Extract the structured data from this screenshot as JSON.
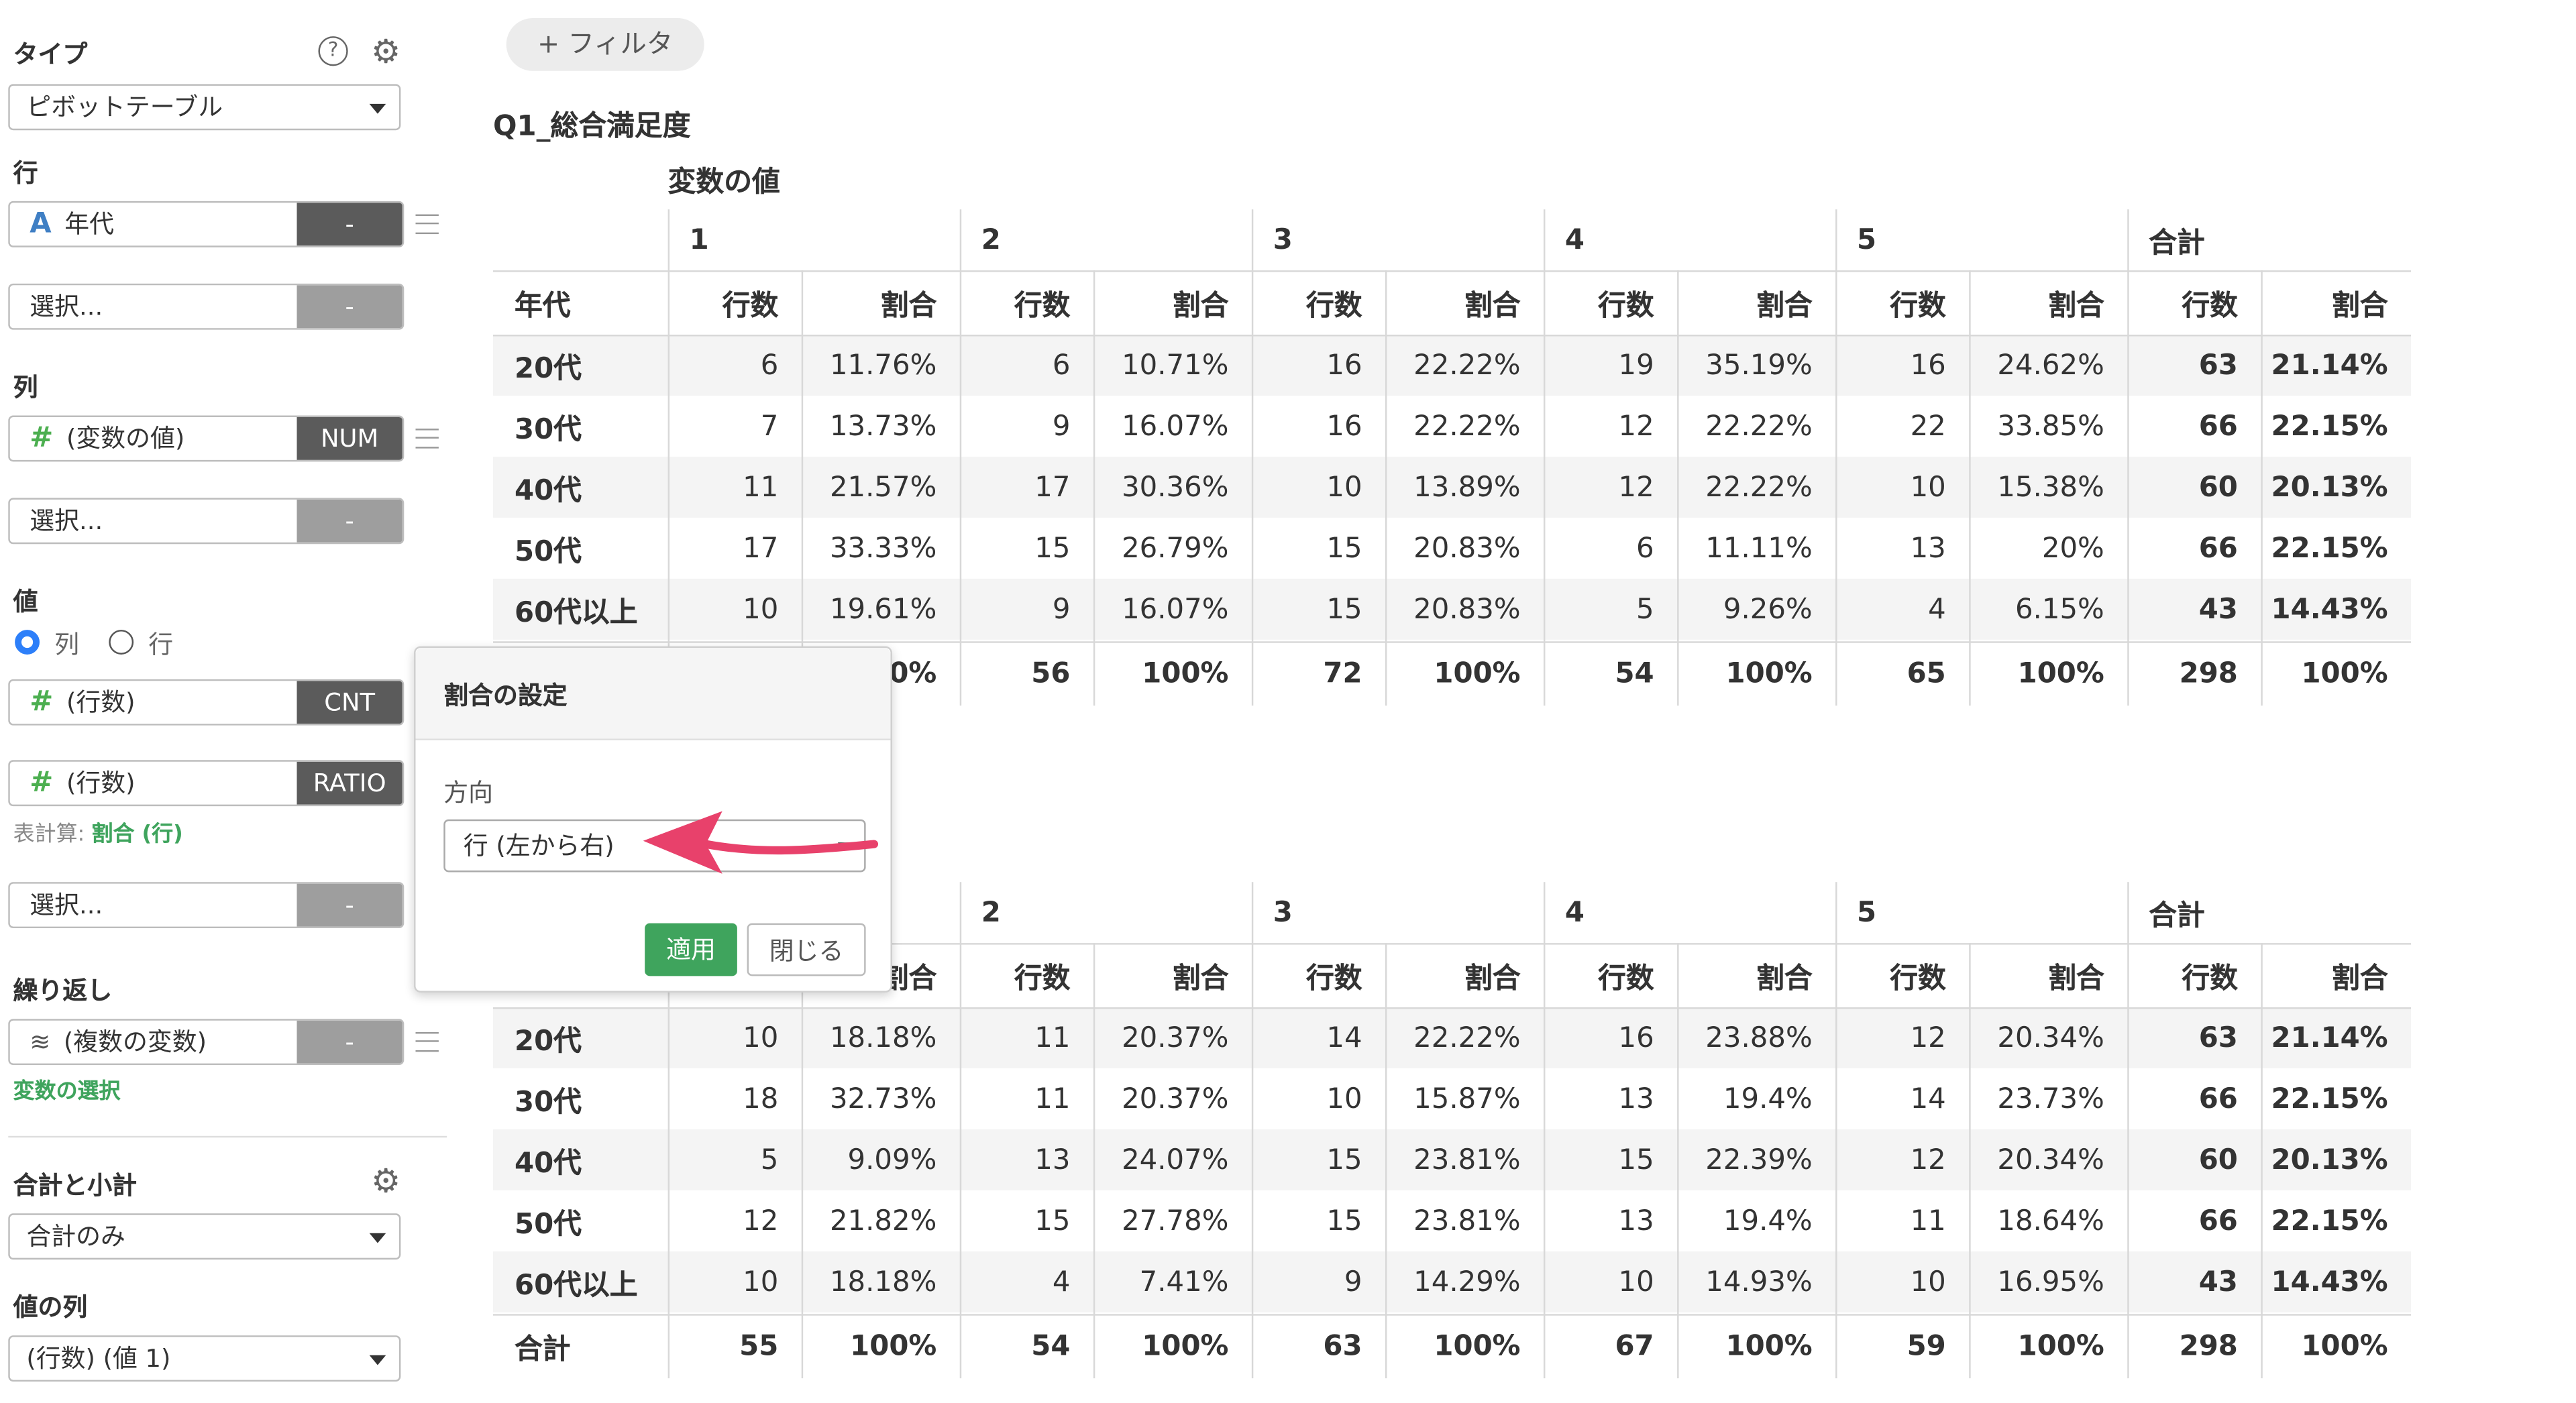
{
  "sidebar": {
    "type_label": "タイプ",
    "type_value": "ピボットテーブル",
    "row_label": "行",
    "row_field": {
      "type": "A",
      "name": "年代",
      "tag": "-"
    },
    "row_select": {
      "name": "選択...",
      "tag": "-"
    },
    "col_label": "列",
    "col_field": {
      "type": "#",
      "name": "(変数の値)",
      "tag": "NUM"
    },
    "col_select": {
      "name": "選択...",
      "tag": "-"
    },
    "value_label": "値",
    "radio_col": "列",
    "radio_row": "行",
    "value_field1": {
      "type": "#",
      "name": "(行数)",
      "tag": "CNT"
    },
    "value_field2": {
      "type": "#",
      "name": "(行数)",
      "tag": "RATIO"
    },
    "calc_prefix": "表計算:",
    "calc_value": "割合 (行)",
    "value_select": {
      "name": "選択...",
      "tag": "-"
    },
    "repeat_label": "繰り返し",
    "repeat_field": {
      "name": "(複数の変数)",
      "tag": "-"
    },
    "var_select_link": "変数の選択",
    "totals_label": "合計と小計",
    "totals_value": "合計のみ",
    "value_col_label": "値の列",
    "value_col_value": "(行数) (値 1)"
  },
  "filter_label": "+ フィルタ",
  "table1": {
    "title": "Q1_総合満足度",
    "subtitle": "変数の値",
    "groups": [
      "1",
      "2",
      "3",
      "4",
      "5",
      "合計"
    ],
    "row_header": "年代",
    "count_label": "行数",
    "ratio_label": "割合",
    "rows": [
      {
        "label": "20代",
        "cells": [
          "6",
          "11.76%",
          "6",
          "10.71%",
          "16",
          "22.22%",
          "19",
          "35.19%",
          "16",
          "24.62%",
          "63",
          "21.14%"
        ]
      },
      {
        "label": "30代",
        "cells": [
          "7",
          "13.73%",
          "9",
          "16.07%",
          "16",
          "22.22%",
          "12",
          "22.22%",
          "22",
          "33.85%",
          "66",
          "22.15%"
        ]
      },
      {
        "label": "40代",
        "cells": [
          "11",
          "21.57%",
          "17",
          "30.36%",
          "10",
          "13.89%",
          "12",
          "22.22%",
          "10",
          "15.38%",
          "60",
          "20.13%"
        ]
      },
      {
        "label": "50代",
        "cells": [
          "17",
          "33.33%",
          "15",
          "26.79%",
          "15",
          "20.83%",
          "6",
          "11.11%",
          "13",
          "20%",
          "66",
          "22.15%"
        ]
      },
      {
        "label": "60代以上",
        "cells": [
          "10",
          "19.61%",
          "9",
          "16.07%",
          "15",
          "20.83%",
          "5",
          "9.26%",
          "4",
          "6.15%",
          "43",
          "14.43%"
        ]
      }
    ],
    "total": {
      "label": "",
      "cells": [
        "",
        "0%",
        "56",
        "100%",
        "72",
        "100%",
        "54",
        "100%",
        "65",
        "100%",
        "298",
        "100%"
      ]
    }
  },
  "table2": {
    "groups": [
      "2",
      "3",
      "4",
      "5",
      "合計"
    ],
    "row_header": "",
    "count_label": "行数",
    "ratio_label": "割合",
    "partial_ratio_label": "割合",
    "rows": [
      {
        "label": "20代",
        "cells": [
          "10",
          "18.18%",
          "11",
          "20.37%",
          "14",
          "22.22%",
          "16",
          "23.88%",
          "12",
          "20.34%",
          "63",
          "21.14%"
        ]
      },
      {
        "label": "30代",
        "cells": [
          "18",
          "32.73%",
          "11",
          "20.37%",
          "10",
          "15.87%",
          "13",
          "19.4%",
          "14",
          "23.73%",
          "66",
          "22.15%"
        ]
      },
      {
        "label": "40代",
        "cells": [
          "5",
          "9.09%",
          "13",
          "24.07%",
          "15",
          "23.81%",
          "15",
          "22.39%",
          "12",
          "20.34%",
          "60",
          "20.13%"
        ]
      },
      {
        "label": "50代",
        "cells": [
          "12",
          "21.82%",
          "15",
          "27.78%",
          "15",
          "23.81%",
          "13",
          "19.4%",
          "11",
          "18.64%",
          "66",
          "22.15%"
        ]
      },
      {
        "label": "60代以上",
        "cells": [
          "10",
          "18.18%",
          "4",
          "7.41%",
          "9",
          "14.29%",
          "10",
          "14.93%",
          "10",
          "16.95%",
          "43",
          "14.43%"
        ]
      }
    ],
    "total": {
      "label": "合計",
      "cells": [
        "55",
        "100%",
        "54",
        "100%",
        "63",
        "100%",
        "67",
        "100%",
        "59",
        "100%",
        "298",
        "100%"
      ]
    }
  },
  "popup": {
    "title": "割合の設定",
    "direction_label": "方向",
    "direction_value": "行 (左から右)",
    "apply": "適用",
    "close": "閉じる"
  },
  "colors": {
    "accent_green": "#3fa45d",
    "arrow": "#e8416b",
    "dark_tag": "#5b5b5b"
  }
}
